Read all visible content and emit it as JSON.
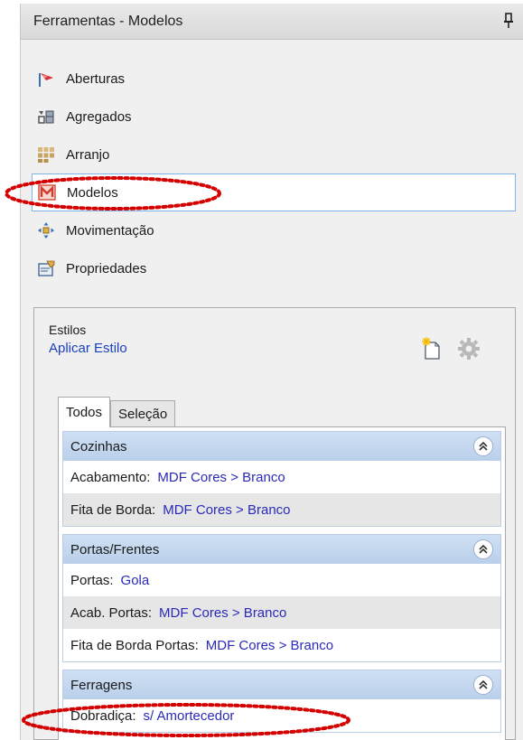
{
  "window": {
    "title": "Ferramentas - Modelos",
    "pin_icon": "pin-icon"
  },
  "nav": {
    "items": [
      {
        "label": "Aberturas",
        "icon": "aberturas-flag-icon"
      },
      {
        "label": "Agregados",
        "icon": "agregados-icon"
      },
      {
        "label": "Arranjo",
        "icon": "arranjo-grid-icon"
      },
      {
        "label": "Modelos",
        "icon": "modelos-m-icon",
        "selected": true
      },
      {
        "label": "Movimentação",
        "icon": "move-arrows-icon"
      },
      {
        "label": "Propriedades",
        "icon": "properties-icon"
      }
    ]
  },
  "estilos": {
    "group_label": "Estilos",
    "apply_link": "Aplicar Estilo"
  },
  "tabs": {
    "items": [
      "Todos",
      "Seleção"
    ],
    "active": "Todos"
  },
  "sections": [
    {
      "title": "Cozinhas",
      "rows": [
        {
          "key": "Acabamento:",
          "value": "MDF Cores > Branco"
        },
        {
          "key": "Fita de Borda:",
          "value": "MDF Cores > Branco"
        }
      ]
    },
    {
      "title": "Portas/Frentes",
      "rows": [
        {
          "key": "Portas:",
          "value": "Gola"
        },
        {
          "key": "Acab. Portas:",
          "value": "MDF Cores > Branco"
        },
        {
          "key": "Fita de Borda Portas:",
          "value": "MDF Cores > Branco"
        }
      ]
    },
    {
      "title": "Ferragens",
      "rows": [
        {
          "key": "Dobradiça:",
          "value": "s/ Amortecedor"
        }
      ]
    }
  ],
  "colors": {
    "link": "#1a3fbf",
    "value_text": "#2a2ab8",
    "section_header": "#c4d7ef",
    "selection_border": "#7eb4ea",
    "annotation_red": "#d40000"
  }
}
